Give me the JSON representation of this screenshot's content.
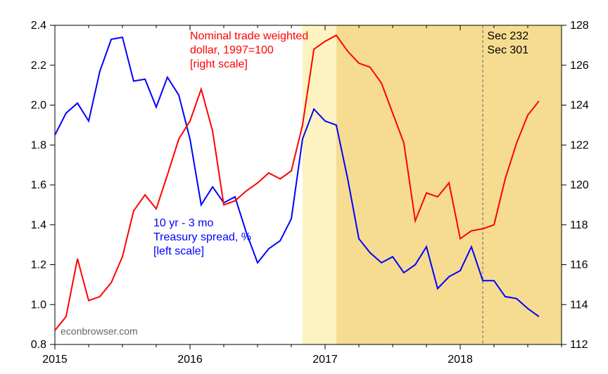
{
  "chart_data": {
    "type": "line",
    "title": "",
    "x": {
      "label": "",
      "ticks": [
        "2015",
        "2016",
        "2017",
        "2018"
      ],
      "range_start": 2015.0,
      "range_end": 2018.75
    },
    "left_axis": {
      "label": "",
      "ticks": [
        "0.8",
        "1.0",
        "1.2",
        "1.4",
        "1.6",
        "1.8",
        "2.0",
        "2.2",
        "2.4"
      ],
      "range": [
        0.8,
        2.4
      ]
    },
    "right_axis": {
      "label": "",
      "ticks": [
        "112",
        "114",
        "116",
        "118",
        "120",
        "122",
        "124",
        "126",
        "128"
      ],
      "range": [
        112,
        128
      ]
    },
    "shaded_regions": [
      {
        "name": "light",
        "x0": 2016.833,
        "x1": 2017.083
      },
      {
        "name": "dark",
        "x0": 2017.083,
        "x1": 2018.75
      }
    ],
    "vlines": [
      {
        "name": "sec232-301",
        "x": 2018.167
      }
    ],
    "series": [
      {
        "name": "10 yr - 3 mo Treasury spread, % [left scale]",
        "axis": "left",
        "color": "#0000ff",
        "x": [
          2015.0,
          2015.083,
          2015.167,
          2015.25,
          2015.333,
          2015.417,
          2015.5,
          2015.583,
          2015.667,
          2015.75,
          2015.833,
          2015.917,
          2016.0,
          2016.083,
          2016.167,
          2016.25,
          2016.333,
          2016.417,
          2016.5,
          2016.583,
          2016.667,
          2016.75,
          2016.833,
          2016.917,
          2017.0,
          2017.083,
          2017.167,
          2017.25,
          2017.333,
          2017.417,
          2017.5,
          2017.583,
          2017.667,
          2017.75,
          2017.833,
          2017.917,
          2018.0,
          2018.083,
          2018.167,
          2018.25,
          2018.333,
          2018.417,
          2018.5,
          2018.583
        ],
        "values": [
          1.85,
          1.96,
          2.01,
          1.92,
          2.17,
          2.33,
          2.34,
          2.12,
          2.13,
          1.99,
          2.14,
          2.05,
          1.83,
          1.5,
          1.59,
          1.51,
          1.54,
          1.36,
          1.21,
          1.28,
          1.32,
          1.43,
          1.83,
          1.98,
          1.92,
          1.9,
          1.63,
          1.33,
          1.26,
          1.21,
          1.24,
          1.16,
          1.2,
          1.29,
          1.08,
          1.14,
          1.17,
          1.29,
          1.12,
          1.12,
          1.04,
          1.03,
          0.98,
          0.94
        ]
      },
      {
        "name": "Nominal trade weighted dollar, 1997=100 [right scale]",
        "axis": "right",
        "color": "#ff0000",
        "x": [
          2015.0,
          2015.083,
          2015.167,
          2015.25,
          2015.333,
          2015.417,
          2015.5,
          2015.583,
          2015.667,
          2015.75,
          2015.833,
          2015.917,
          2016.0,
          2016.083,
          2016.167,
          2016.25,
          2016.333,
          2016.417,
          2016.5,
          2016.583,
          2016.667,
          2016.75,
          2016.833,
          2016.917,
          2017.0,
          2017.083,
          2017.167,
          2017.25,
          2017.333,
          2017.417,
          2017.5,
          2017.583,
          2017.667,
          2017.75,
          2017.833,
          2017.917,
          2018.0,
          2018.083,
          2018.167,
          2018.25,
          2018.333,
          2018.417,
          2018.5,
          2018.583
        ],
        "values": [
          112.7,
          113.4,
          116.3,
          114.2,
          114.4,
          115.1,
          116.4,
          118.7,
          119.5,
          118.8,
          120.5,
          122.3,
          123.2,
          124.8,
          122.7,
          119.0,
          119.2,
          119.7,
          120.1,
          120.6,
          120.3,
          120.7,
          123.0,
          126.8,
          127.2,
          127.5,
          126.7,
          126.1,
          125.9,
          125.1,
          123.6,
          122.1,
          118.2,
          119.6,
          119.4,
          120.1,
          117.3,
          117.7,
          117.8,
          118.0,
          120.3,
          122.1,
          123.5,
          124.2
        ]
      }
    ],
    "annotations": {
      "red1": "Nominal trade weighted",
      "red2": "dollar, 1997=100",
      "red3": "[right scale]",
      "blue1": "10 yr - 3 mo",
      "blue2": "Treasury spread, %",
      "blue3": "[left scale]",
      "black1": "Sec 232",
      "black2": "Sec 301",
      "source": "econbrowser.com"
    }
  }
}
